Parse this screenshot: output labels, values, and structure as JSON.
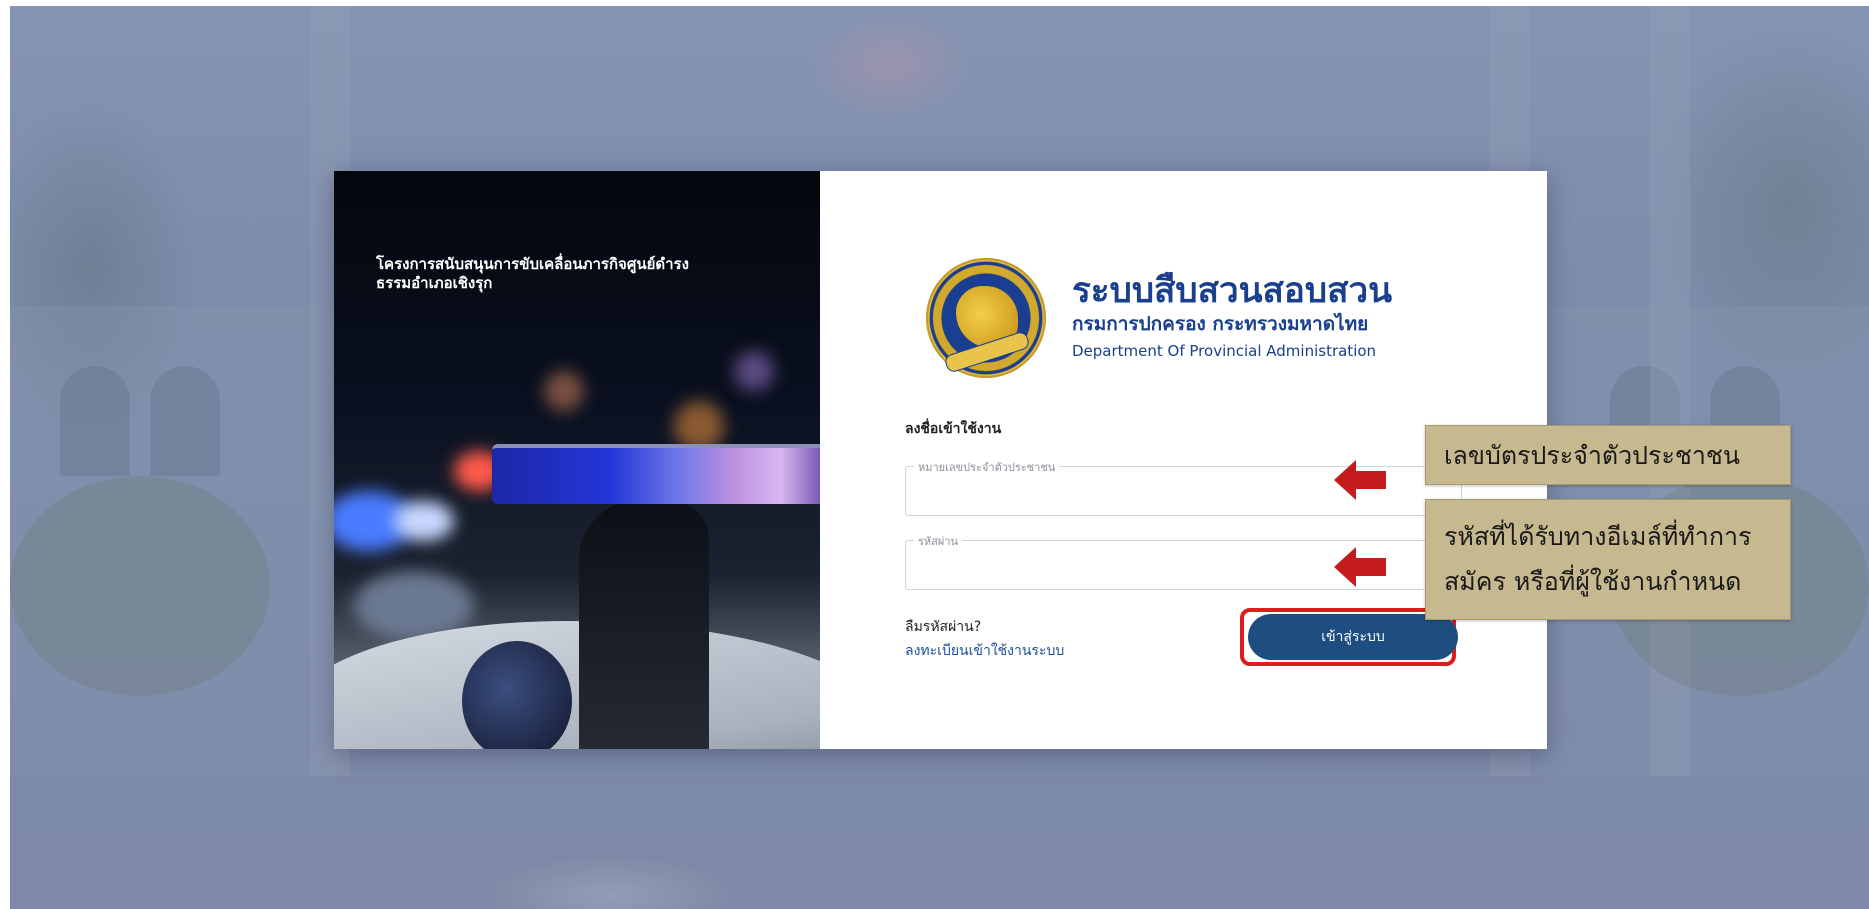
{
  "colors": {
    "brand_blue": "#1a3f8c",
    "button": "#1e4e80",
    "highlight_red": "#e01b1b",
    "callout_bg": "#c6b88f",
    "arrow": "#c41c1c",
    "link": "#1d4f9a"
  },
  "hero": {
    "title_line1": "โครงการสนับสนุนการขับเคลื่อนภารกิจศูนย์ดำรง",
    "title_line2": "ธรรมอำเภอเชิงรุก"
  },
  "branding": {
    "logo_icon": "dopa-seal-icon",
    "system_title": "ระบบสืบสวนสอบสวน",
    "department_thai": "กรมการปกครอง กระทรวงมหาดไทย",
    "department_english": "Department Of Provincial Administration"
  },
  "login": {
    "heading": "ลงชื่อเข้าใช้งาน",
    "id_field": {
      "label": "หมายเลขประจำตัวประชาชน",
      "value": ""
    },
    "password_field": {
      "label": "รหัสผ่าน",
      "value": ""
    },
    "forgot_link": "ลืมรหัสผ่าน?",
    "register_link": "ลงทะเบียนเข้าใช้งานระบบ",
    "submit_button": "เข้าสู่ระบบ"
  },
  "annotations": {
    "id_callout": "เลขบัตรประจำตัวประชาชน",
    "password_callout_line1": "รหัสที่ได้รับทางอีเมล์ที่ทำการ",
    "password_callout_line2": "สมัคร หรือที่ผู้ใช้งานกำหนด",
    "arrow_icon": "left-arrow-icon"
  }
}
